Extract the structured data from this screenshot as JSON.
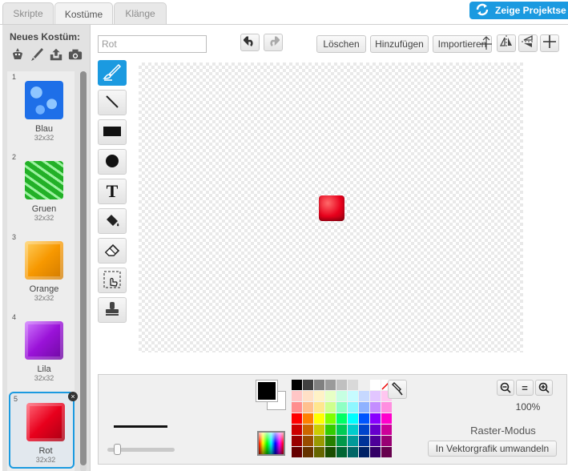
{
  "tabs": [
    "Skripte",
    "Kostüme",
    "Klänge"
  ],
  "share_button": "Zeige Projektse",
  "sidebar": {
    "title": "Neues Kostüm:",
    "new_costume_icons": [
      "sprite-library-icon",
      "paint-brush-icon",
      "upload-icon",
      "camera-icon"
    ]
  },
  "costumes": [
    {
      "index": "1",
      "name": "Blau",
      "size": "32x32",
      "color": "#1e6fe8"
    },
    {
      "index": "2",
      "name": "Gruen",
      "size": "32x32",
      "color": "#22b027"
    },
    {
      "index": "3",
      "name": "Orange",
      "size": "32x32",
      "color": "#f79800"
    },
    {
      "index": "4",
      "name": "Lila",
      "size": "32x32",
      "color": "#9a12d8"
    },
    {
      "index": "5",
      "name": "Rot",
      "size": "32x32",
      "color": "#e8001c"
    }
  ],
  "delete_label": "×",
  "editor": {
    "costume_name": "Rot",
    "clear_label": "Löschen",
    "add_label": "Hinzufügen",
    "import_label": "Importieren"
  },
  "tools": [
    "paintbrush-tool-icon",
    "line-tool-icon",
    "rectangle-tool-icon",
    "ellipse-tool-icon",
    "text-tool-icon",
    "fill-tool-icon",
    "eraser-tool-icon",
    "select-tool-icon",
    "stamp-tool-icon"
  ],
  "text_tool_glyph": "T",
  "bottom": {
    "zoom_level": "100%",
    "mode": "Raster-Modus",
    "convert_label": "In Vektorgrafik umwandeln",
    "zoom_out": "−",
    "zoom_reset": "=",
    "zoom_in": "+"
  },
  "palette": [
    "#000000",
    "#404040",
    "#808080",
    "#9a9a9a",
    "#c0c0c0",
    "#d9d9d9",
    "#efefef",
    "#ffffff",
    "none",
    "#ffc6c6",
    "#ffe0c6",
    "#fff2c6",
    "#e7ffc6",
    "#c6ffe2",
    "#c6fbff",
    "#c6d8ff",
    "#e2c6ff",
    "#ffc6f0",
    "#ff8e8e",
    "#ffc08e",
    "#ffe68e",
    "#cfff8e",
    "#8effc4",
    "#8ef7ff",
    "#8eb2ff",
    "#c48eff",
    "#ff8ee0",
    "#ff0000",
    "#ff8000",
    "#ffff00",
    "#80ff00",
    "#00ff66",
    "#00ffff",
    "#0055ff",
    "#8800ff",
    "#ff00cc",
    "#cc0000",
    "#cc6600",
    "#cccc00",
    "#33cc00",
    "#00cc55",
    "#00cccc",
    "#0044cc",
    "#6600cc",
    "#cc0099",
    "#990000",
    "#994c00",
    "#999900",
    "#268000",
    "#00994a",
    "#009999",
    "#003399",
    "#4d0099",
    "#990073",
    "#660000",
    "#663300",
    "#666600",
    "#1a4d00",
    "#006633",
    "#006666",
    "#002266",
    "#330066",
    "#66004d"
  ]
}
